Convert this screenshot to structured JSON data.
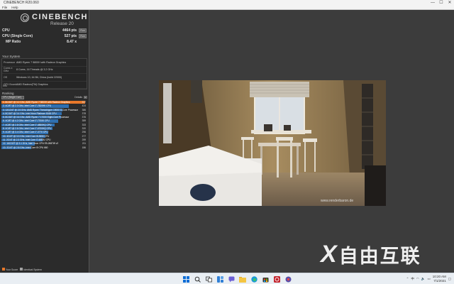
{
  "window": {
    "title": "CINEBENCH R20.060",
    "controls": [
      "—",
      "☐",
      "✕"
    ]
  },
  "menu": [
    "File",
    "Help"
  ],
  "logo": {
    "name": "CINEBENCH",
    "release": "Release 20"
  },
  "scores": [
    {
      "label": "CPU",
      "value": "4464 pts",
      "button": "Run"
    },
    {
      "label": "CPU (Single Core)",
      "value": "527 pts",
      "button": "Run"
    },
    {
      "label": "MP Ratio",
      "value": "8.47 x",
      "button": ""
    }
  ],
  "system": {
    "title": "Your System",
    "rows": [
      {
        "key": "Processor",
        "value": "AMD Ryzen 7 5800H with Radeon Graphics"
      },
      {
        "key": "Cores x GHz",
        "value": "8 Cores, 16 Threads @ 3.2 GHz"
      },
      {
        "key": "OS",
        "value": "Windows 10, 64 Bit, China (build 22000)"
      },
      {
        "key": "GFX Board",
        "value": "AMD Radeon(TM) Graphics"
      }
    ],
    "info_key": "Info"
  },
  "ranking": {
    "title": "Ranking",
    "select": "CPU (Single Core)",
    "details": "Details",
    "max": 540,
    "items": [
      {
        "label": "1. 8C/16T @ 3.2 GHz, AMD Ryzen 7 5800H with Radeon Graphics",
        "score": 527,
        "you": true
      },
      {
        "label": "2. 4C/8T @ 2.3 GHz, Intel Core i7-7820HK CPU",
        "score": 424,
        "you": false
      },
      {
        "label": "3. 12C/24T @ 2.5 GHz, AMD Ryzen Threadripper 1900X 8-Core Processor",
        "score": 386,
        "you": false
      },
      {
        "label": "4. 8C/16T @ 3.4 GHz, Intel Xeon Platinum 8168 CPU",
        "score": 378,
        "you": false
      },
      {
        "label": "5. 8C/16T @ 3.6 GHz, AMD Ryzen 7 1700X Eight-Core Processor",
        "score": 376,
        "you": false
      },
      {
        "label": "6. 4C/8T @ 4.2 GHz, Intel Core i7-7700K CPU",
        "score": 359,
        "you": false
      },
      {
        "label": "7. 4C/8T @ 2.8 GHz, Intel Core i7-4850HQ CPU",
        "score": 333,
        "you": false
      },
      {
        "label": "8. 4C/8T @ 2.6 GHz, Intel Core i7-6700HQ CPU",
        "score": 320,
        "you": false
      },
      {
        "label": "9. 4C/8T @ 3.4 GHz, Intel Core i7-3770 CPU",
        "score": 296,
        "you": false
      },
      {
        "label": "10. 4C/4T @ 3.3 GHz, Intel Core i5-3550 CPU",
        "score": 277,
        "you": false
      },
      {
        "label": "11. 2C/4T @ 2.3 GHz, Intel Core i7-4650U CPU",
        "score": 259,
        "you": false
      },
      {
        "label": "12. 16C/32T @ 3.1 GHz, Intel Xeon CPU E5-2687W v2",
        "score": 211,
        "you": false
      },
      {
        "label": "13. 2C/4T @ 2.8 GHz, Intel Core i5 CPU 660",
        "score": 186,
        "you": false
      }
    ],
    "colors": {
      "you": "#e8782a",
      "others": "#2f6fb0"
    }
  },
  "legend": [
    {
      "label": "Your Score",
      "color": "#e8782a"
    },
    {
      "label": "Identical System",
      "color": "#a3a3a3"
    }
  ],
  "render_credit": "www.renderbaron.de",
  "taskbar": {
    "icons": [
      "windows-icon",
      "search-icon",
      "task-view-icon",
      "widgets-icon",
      "chat-icon",
      "file-explorer-icon",
      "edge-icon",
      "store-icon",
      "cinebench-icon",
      "app-icon"
    ],
    "tray_lang": "中",
    "time": "10:20 AM",
    "date": "7/1/2021"
  },
  "watermark": {
    "mark": "X",
    "text": "自由互联"
  }
}
